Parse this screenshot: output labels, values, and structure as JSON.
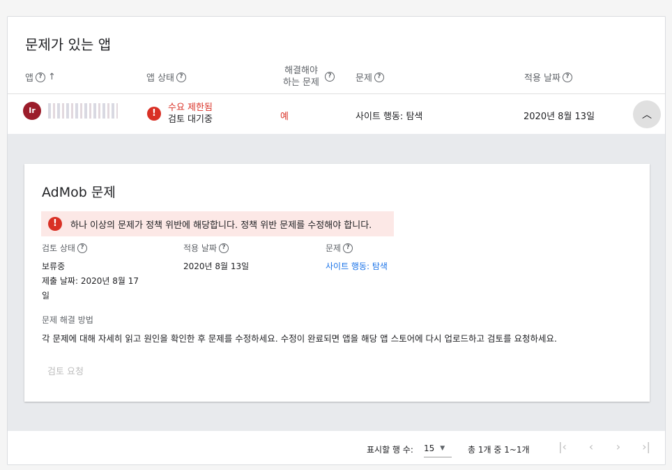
{
  "card": {
    "title": "문제가 있는 앱"
  },
  "headers": {
    "app": "앱",
    "app_status": "앱 상태",
    "must_fix_line1": "해결해야",
    "must_fix_line2": "하는 문제",
    "issue": "문제",
    "applied_date": "적용 날짜"
  },
  "row": {
    "avatar_text": "Ir",
    "status_primary": "수요 제한됨",
    "status_secondary": "검토 대기중",
    "must_fix": "예",
    "issue": "사이트 행동: 탐색",
    "date": "2020년 8월 13일",
    "collapse_icon": "chevron-up-icon"
  },
  "detail": {
    "title": "AdMob 문제",
    "alert_text": "하나 이상의 문제가 정책 위반에 해당합니다. 정책 위반 문제를 수정해야 합니다.",
    "review_status_label": "검토 상태",
    "review_status_value": "보류중",
    "submitted_line1": "제출 날짜: 2020년 8월 17",
    "submitted_line2": "일",
    "applied_date_label": "적용 날짜",
    "applied_date_value": "2020년 8월 13일",
    "issue_label": "문제",
    "issue_link": "사이트 행동: 탐색",
    "resolution_label": "문제 해결 방법",
    "resolution_text": "각 문제에 대해 자세히 읽고 원인을 확인한 후 문제를 수정하세요. 수정이 완료되면 앱을 해당 앱 스토어에 다시 업로드하고 검토를 요청하세요.",
    "review_button": "검토 요청"
  },
  "footer": {
    "rows_label": "표시할 행 수:",
    "rows_value": "15",
    "range": "총 1개 중 1~1개"
  },
  "colors": {
    "error": "#d93025",
    "link": "#1a73e8",
    "alert_bg": "#fce8e6"
  }
}
